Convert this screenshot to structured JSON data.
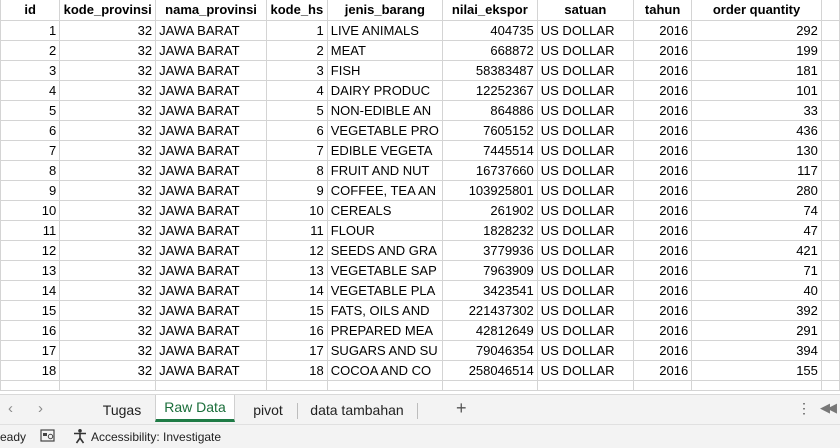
{
  "columns": [
    "id",
    "kode_provinsi",
    "nama_provinsi",
    "kode_hs",
    "jenis_barang",
    "nilai_ekspor",
    "satuan",
    "tahun",
    "order quantity"
  ],
  "rows": [
    [
      "1",
      "32",
      "JAWA BARAT",
      "1",
      "LIVE ANIMALS",
      "404735",
      "US DOLLAR",
      "2016",
      "292"
    ],
    [
      "2",
      "32",
      "JAWA BARAT",
      "2",
      "MEAT",
      "668872",
      "US DOLLAR",
      "2016",
      "199"
    ],
    [
      "3",
      "32",
      "JAWA BARAT",
      "3",
      "FISH",
      "58383487",
      "US DOLLAR",
      "2016",
      "181"
    ],
    [
      "4",
      "32",
      "JAWA BARAT",
      "4",
      "DAIRY PRODUC",
      "12252367",
      "US DOLLAR",
      "2016",
      "101"
    ],
    [
      "5",
      "32",
      "JAWA BARAT",
      "5",
      "NON-EDIBLE AN",
      "864886",
      "US DOLLAR",
      "2016",
      "33"
    ],
    [
      "6",
      "32",
      "JAWA BARAT",
      "6",
      "VEGETABLE PRO",
      "7605152",
      "US DOLLAR",
      "2016",
      "436"
    ],
    [
      "7",
      "32",
      "JAWA BARAT",
      "7",
      "EDIBLE VEGETA",
      "7445514",
      "US DOLLAR",
      "2016",
      "130"
    ],
    [
      "8",
      "32",
      "JAWA BARAT",
      "8",
      "FRUIT AND NUT",
      "16737660",
      "US DOLLAR",
      "2016",
      "117"
    ],
    [
      "9",
      "32",
      "JAWA BARAT",
      "9",
      "COFFEE, TEA AN",
      "103925801",
      "US DOLLAR",
      "2016",
      "280"
    ],
    [
      "10",
      "32",
      "JAWA BARAT",
      "10",
      "CEREALS",
      "261902",
      "US DOLLAR",
      "2016",
      "74"
    ],
    [
      "11",
      "32",
      "JAWA BARAT",
      "11",
      "FLOUR",
      "1828232",
      "US DOLLAR",
      "2016",
      "47"
    ],
    [
      "12",
      "32",
      "JAWA BARAT",
      "12",
      "SEEDS AND GRA",
      "3779936",
      "US DOLLAR",
      "2016",
      "421"
    ],
    [
      "13",
      "32",
      "JAWA BARAT",
      "13",
      "VEGETABLE SAP",
      "7963909",
      "US DOLLAR",
      "2016",
      "71"
    ],
    [
      "14",
      "32",
      "JAWA BARAT",
      "14",
      "VEGETABLE PLA",
      "3423541",
      "US DOLLAR",
      "2016",
      "40"
    ],
    [
      "15",
      "32",
      "JAWA BARAT",
      "15",
      "FATS, OILS AND",
      "221437302",
      "US DOLLAR",
      "2016",
      "392"
    ],
    [
      "16",
      "32",
      "JAWA BARAT",
      "16",
      "PREPARED MEA",
      "42812649",
      "US DOLLAR",
      "2016",
      "291"
    ],
    [
      "17",
      "32",
      "JAWA BARAT",
      "17",
      "SUGARS AND SU",
      "79046354",
      "US DOLLAR",
      "2016",
      "394"
    ],
    [
      "18",
      "32",
      "JAWA BARAT",
      "18",
      "COCOA AND CO",
      "258046514",
      "US DOLLAR",
      "2016",
      "155"
    ]
  ],
  "sheet_tabs": [
    {
      "label": "Tugas",
      "active": false
    },
    {
      "label": "Raw Data",
      "active": true
    },
    {
      "label": "pivot",
      "active": false
    },
    {
      "label": "data tambahan",
      "active": false
    }
  ],
  "tabbar": {
    "prev_icon": "chevron-left-icon",
    "next_icon": "chevron-right-icon",
    "add_label": "+",
    "more_label": "⋮"
  },
  "status": {
    "ready": "eady",
    "accessibility": "Accessibility: Investigate"
  },
  "colors": {
    "active_tab": "#1e7b45",
    "grid_border": "#d4d4d4",
    "tabbar_bg": "#f3f3f3"
  }
}
